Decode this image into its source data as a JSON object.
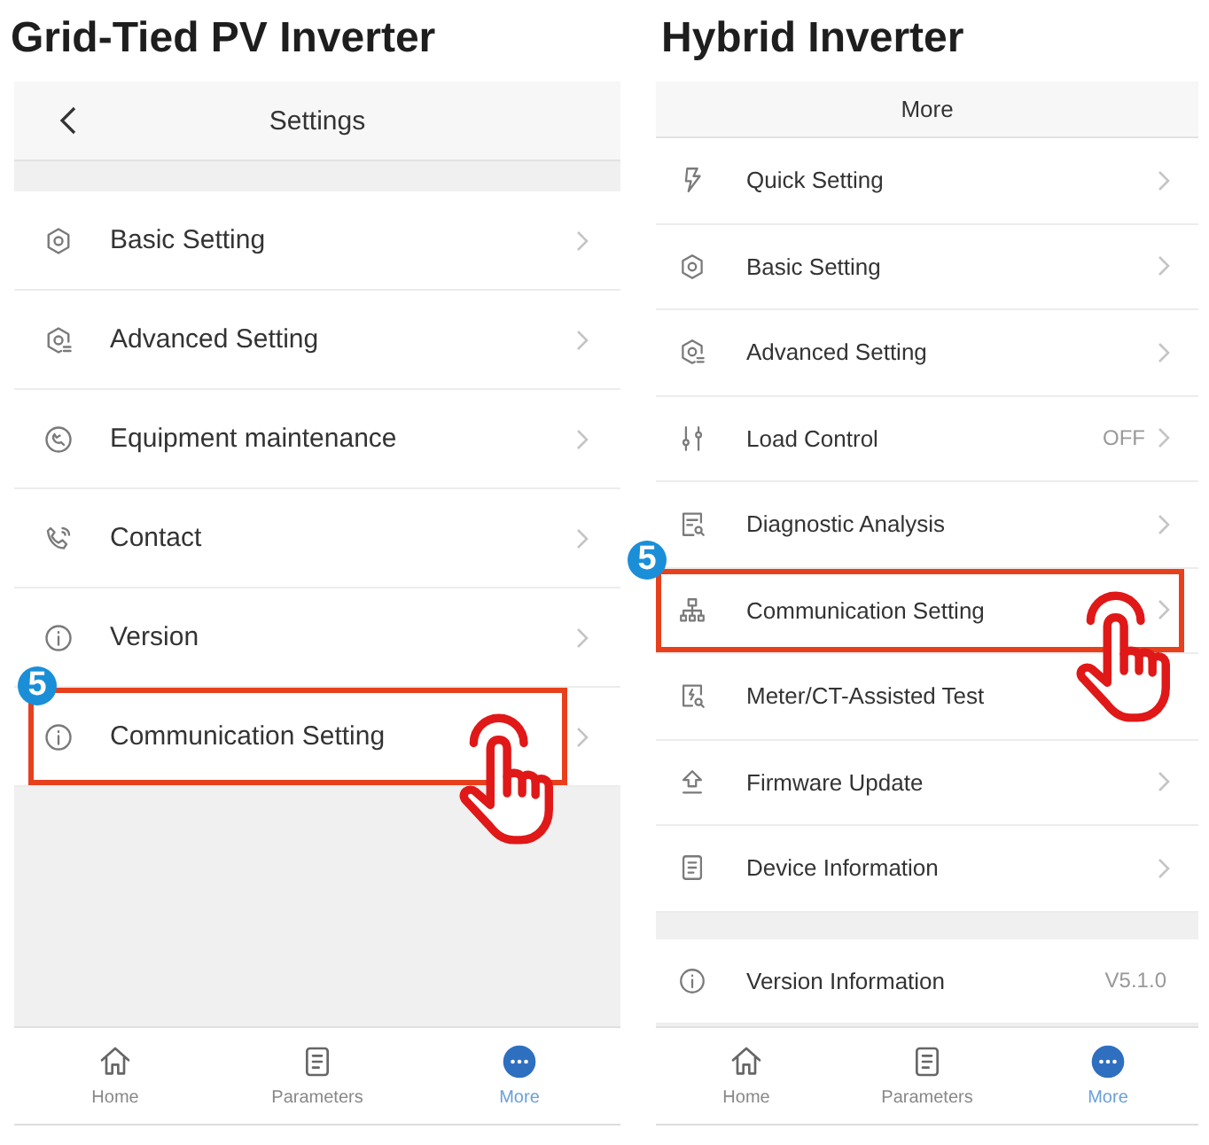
{
  "panels": [
    {
      "title": "Grid-Tied PV Inverter",
      "header": {
        "title": "Settings",
        "back": true
      },
      "groups": [
        [
          {
            "kind": "gear",
            "label": "Basic Setting",
            "chevron": true,
            "highlighted": false
          },
          {
            "kind": "gear-plus",
            "label": "Advanced Setting",
            "chevron": true,
            "highlighted": false
          },
          {
            "kind": "maintenance",
            "label": "Equipment maintenance",
            "chevron": true,
            "highlighted": false
          },
          {
            "kind": "phone",
            "label": "Contact",
            "chevron": true,
            "highlighted": false
          },
          {
            "kind": "info",
            "label": "Version",
            "chevron": true,
            "highlighted": false
          },
          {
            "kind": "info",
            "label": "Communication Setting",
            "chevron": true,
            "highlighted": true,
            "step": "5"
          }
        ]
      ],
      "tabs": [
        {
          "kind": "home",
          "label": "Home",
          "selected": false
        },
        {
          "kind": "document",
          "label": "Parameters",
          "selected": false
        },
        {
          "kind": "more",
          "label": "More",
          "selected": true
        }
      ]
    },
    {
      "title": "Hybrid Inverter",
      "header": {
        "title": "More",
        "back": false
      },
      "groups": [
        [
          {
            "kind": "bolt",
            "label": "Quick Setting",
            "chevron": true,
            "highlighted": false
          },
          {
            "kind": "gear",
            "label": "Basic Setting",
            "chevron": true,
            "highlighted": false
          },
          {
            "kind": "gear-plus",
            "label": "Advanced Setting",
            "chevron": true,
            "highlighted": false
          },
          {
            "kind": "sliders",
            "label": "Load Control",
            "value": "OFF",
            "chevron": true,
            "highlighted": false
          },
          {
            "kind": "diagnostic",
            "label": "Diagnostic Analysis",
            "chevron": true,
            "highlighted": false
          },
          {
            "kind": "network",
            "label": "Communication Setting",
            "chevron": true,
            "highlighted": true,
            "step": "5"
          },
          {
            "kind": "meter",
            "label": "Meter/CT-Assisted Test",
            "chevron": false,
            "highlighted": false
          },
          {
            "kind": "upload",
            "label": "Firmware Update",
            "chevron": true,
            "highlighted": false
          },
          {
            "kind": "document",
            "label": "Device Information",
            "chevron": true,
            "highlighted": false
          }
        ],
        [
          {
            "kind": "info",
            "label": "Version Information",
            "value": "V5.1.0",
            "chevron": false,
            "highlighted": false
          }
        ]
      ],
      "tabs": [
        {
          "kind": "home",
          "label": "Home",
          "selected": false
        },
        {
          "kind": "document",
          "label": "Parameters",
          "selected": false
        },
        {
          "kind": "more",
          "label": "More",
          "selected": true
        }
      ]
    }
  ]
}
